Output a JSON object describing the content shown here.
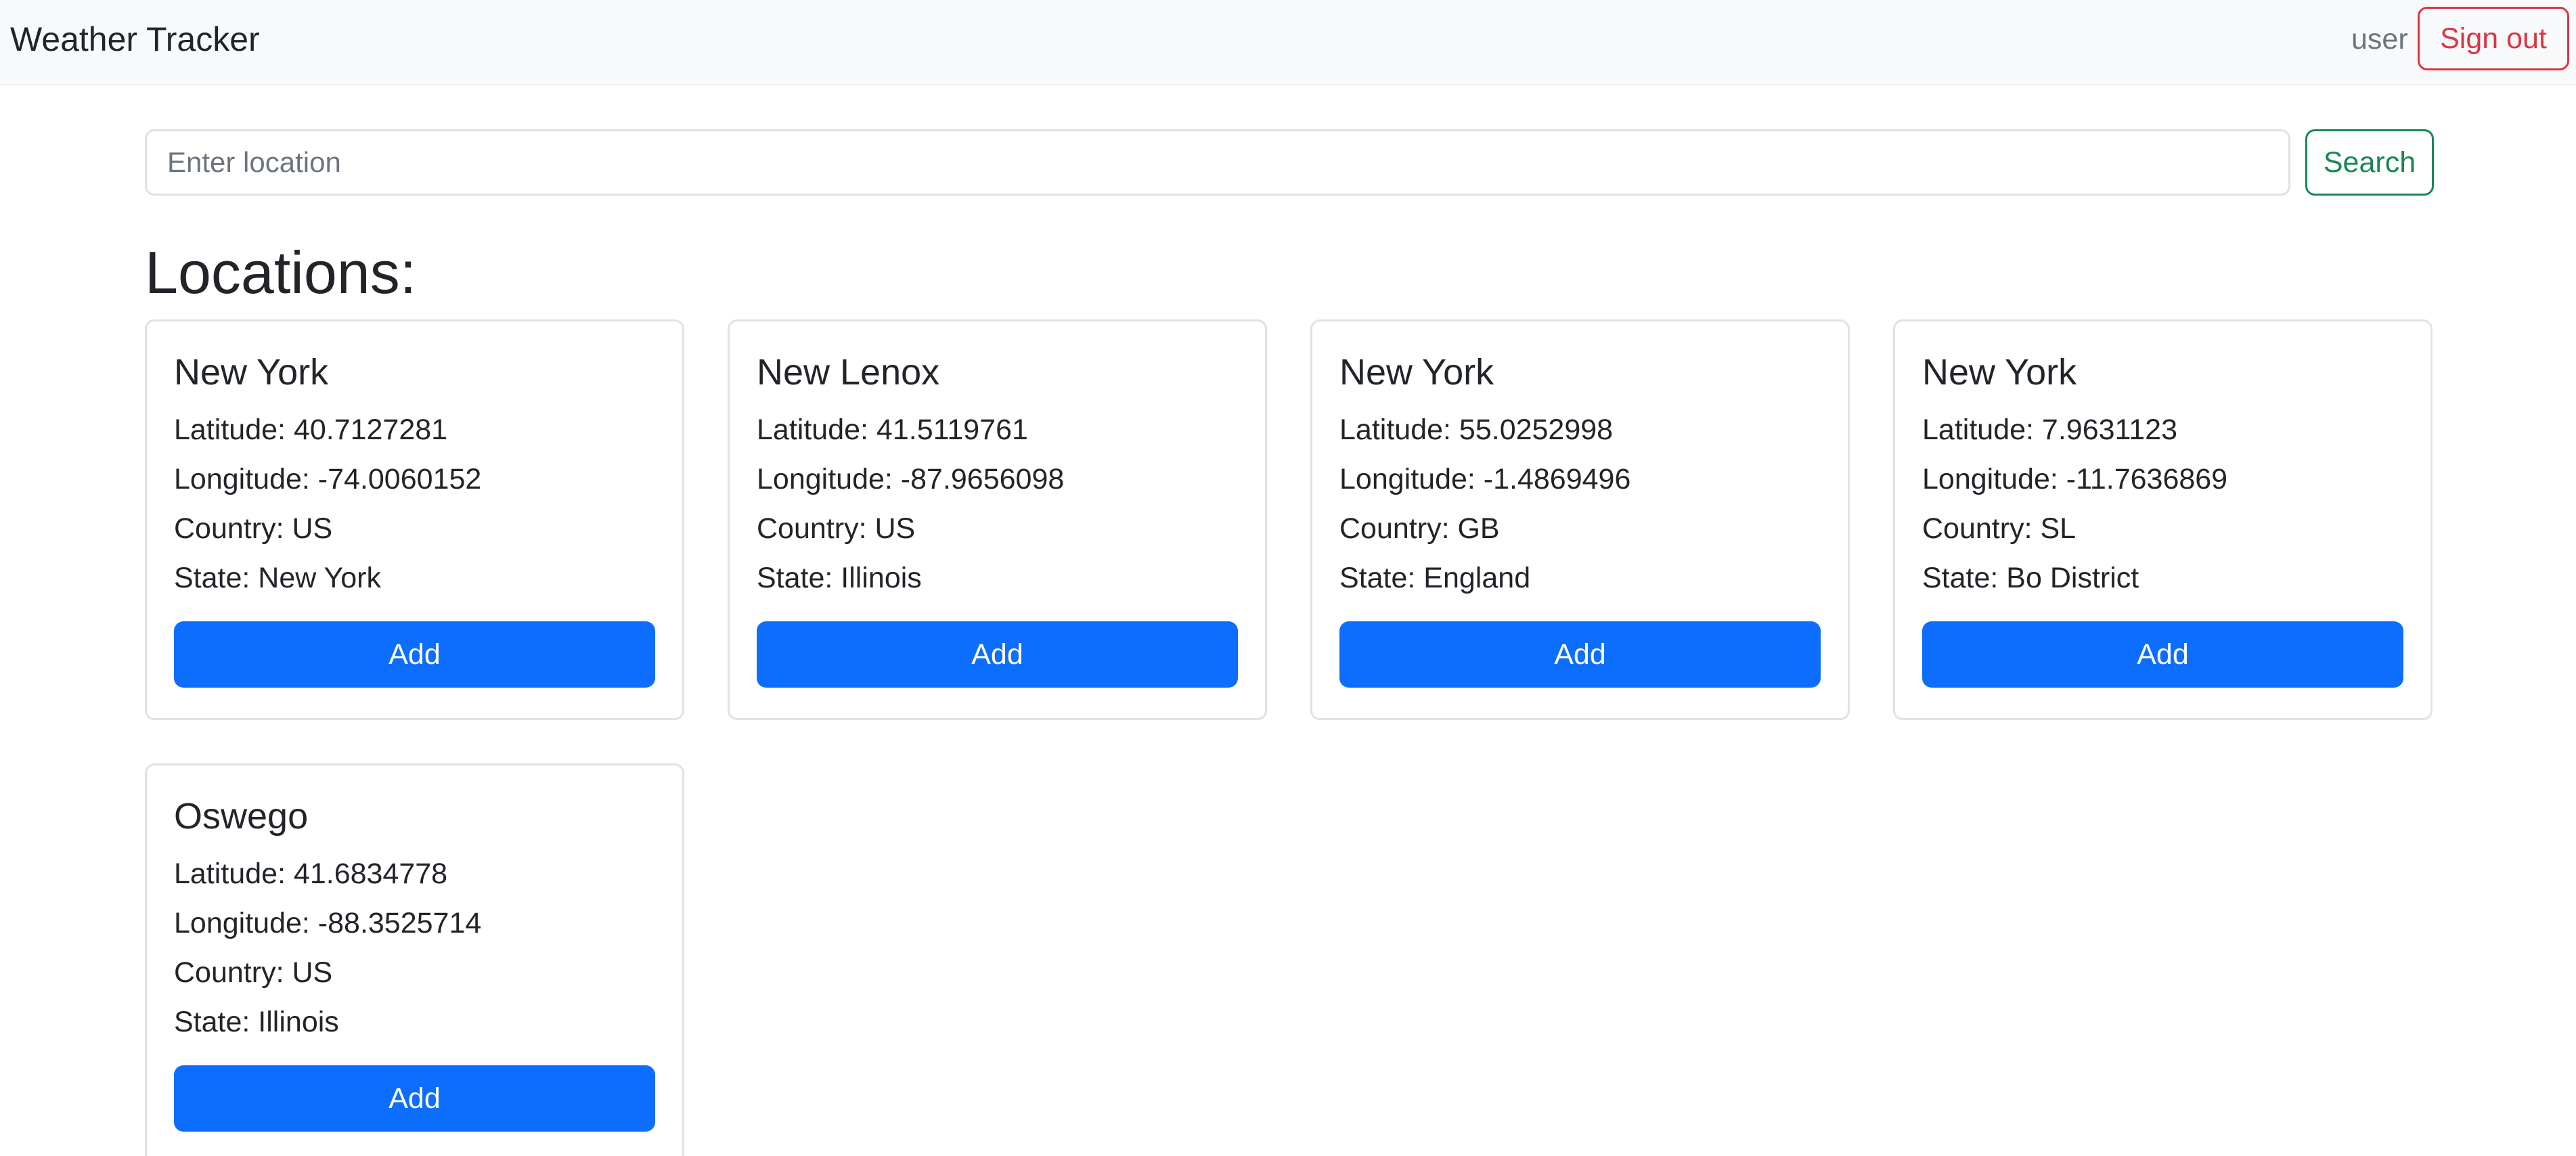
{
  "navbar": {
    "brand": "Weather Tracker",
    "user": "user",
    "signout_label": "Sign out"
  },
  "search": {
    "placeholder": "Enter location",
    "value": "",
    "button_label": "Search"
  },
  "locations_title": "Locations:",
  "locations": [
    {
      "name": "New York",
      "latitude": "Latitude: 40.7127281",
      "longitude": "Longitude: -74.0060152",
      "country": "Country: US",
      "state": "State: New York",
      "add_label": "Add"
    },
    {
      "name": "New Lenox",
      "latitude": "Latitude: 41.5119761",
      "longitude": "Longitude: -87.9656098",
      "country": "Country: US",
      "state": "State: Illinois",
      "add_label": "Add"
    },
    {
      "name": "New York",
      "latitude": "Latitude: 55.0252998",
      "longitude": "Longitude: -1.4869496",
      "country": "Country: GB",
      "state": "State: England",
      "add_label": "Add"
    },
    {
      "name": "New York",
      "latitude": "Latitude: 7.9631123",
      "longitude": "Longitude: -11.7636869",
      "country": "Country: SL",
      "state": "State: Bo District",
      "add_label": "Add"
    },
    {
      "name": "Oswego",
      "latitude": "Latitude: 41.6834778",
      "longitude": "Longitude: -88.3525714",
      "country": "Country: US",
      "state": "State: Illinois",
      "add_label": "Add"
    }
  ],
  "colors": {
    "primary": "#0d6efd",
    "danger": "#dc3545",
    "success": "#198754",
    "navbar_bg": "#f8f9fa"
  }
}
